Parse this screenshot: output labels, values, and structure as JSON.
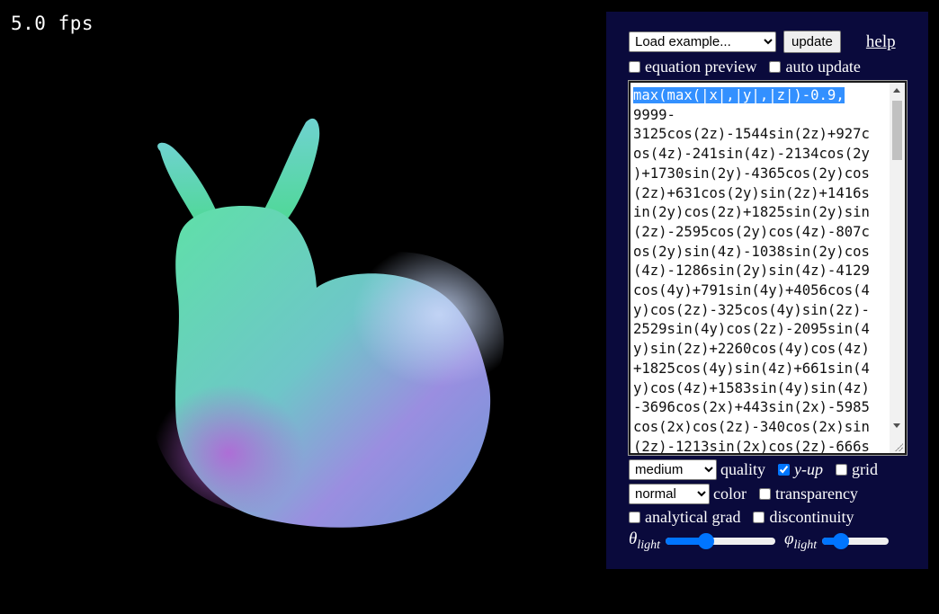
{
  "fps_display": "5.0 fps",
  "toolbar": {
    "example_select": "Load example...",
    "update_label": "update",
    "help_label": "help"
  },
  "options": {
    "equation_preview": {
      "label": "equation preview",
      "checked": false
    },
    "auto_update": {
      "label": "auto update",
      "checked": false
    }
  },
  "equation": {
    "selected_line": "max(max(|x|,|y|,|z|)-0.9,",
    "lines": [
      "9999-",
      "3125cos(2z)-1544sin(2z)+927c",
      "os(4z)-241sin(4z)-2134cos(2y",
      ")+1730sin(2y)-4365cos(2y)cos",
      "(2z)+631cos(2y)sin(2z)+1416s",
      "in(2y)cos(2z)+1825sin(2y)sin",
      "(2z)-2595cos(2y)cos(4z)-807c",
      "os(2y)sin(4z)-1038sin(2y)cos",
      "(4z)-1286sin(2y)sin(4z)-4129",
      "cos(4y)+791sin(4y)+4056cos(4",
      "y)cos(2z)-325cos(4y)sin(2z)-",
      "2529sin(4y)cos(2z)-2095sin(4",
      "y)sin(2z)+2260cos(4y)cos(4z)",
      "+1825cos(4y)sin(4z)+661sin(4",
      "y)cos(4z)+1583sin(4y)sin(4z)",
      "-3696cos(2x)+443sin(2x)-5985",
      "cos(2x)cos(2z)-340cos(2x)sin",
      "(2z)-1213sin(2x)cos(2z)-666s"
    ]
  },
  "render": {
    "quality_select": "medium",
    "quality_label": "quality",
    "y_up": {
      "label": "y-up",
      "checked": true
    },
    "grid": {
      "label": "grid",
      "checked": false
    },
    "color_select": "normal",
    "color_label": "color",
    "transparency": {
      "label": "transparency",
      "checked": false
    },
    "analytical_grad": {
      "label": "analytical grad",
      "checked": false
    },
    "discontinuity": {
      "label": "discontinuity",
      "checked": false
    }
  },
  "lighting": {
    "theta_symbol": "θ",
    "theta_sub": "light",
    "theta_value": 0.35,
    "phi_symbol": "φ",
    "phi_sub": "light",
    "phi_value": 0.22
  },
  "colors": {
    "panel_bg": "#0a0a3c",
    "accent": "#0075ff"
  }
}
